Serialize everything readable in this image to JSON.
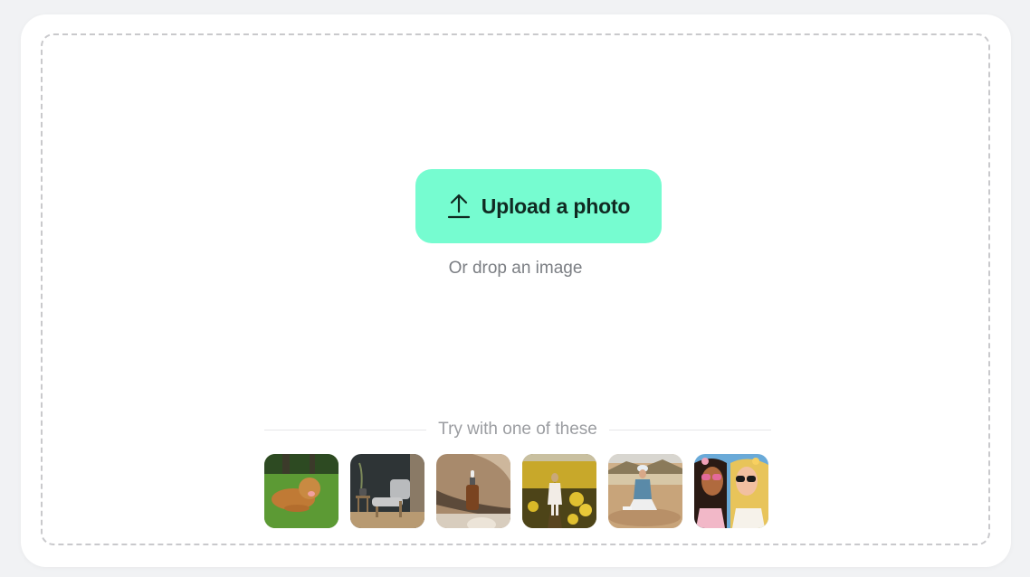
{
  "upload": {
    "button_label": "Upload a photo",
    "icon": "upload-arrow-icon",
    "drop_hint": "Or drop an image",
    "accent_color": "#76fcd0"
  },
  "samples": {
    "heading": "Try with one of these",
    "items": [
      {
        "name": "sample-dog",
        "description": "Golden retriever lying on grass"
      },
      {
        "name": "sample-chair",
        "description": "Armchair with side table and vase"
      },
      {
        "name": "sample-bottle",
        "description": "Amber dropper bottle on driftwood"
      },
      {
        "name": "sample-field",
        "description": "Child walking in yellow flower field"
      },
      {
        "name": "sample-desert",
        "description": "Woman sitting on rocks in desert"
      },
      {
        "name": "sample-illustration",
        "description": "Illustration of two women in sunglasses"
      }
    ]
  }
}
